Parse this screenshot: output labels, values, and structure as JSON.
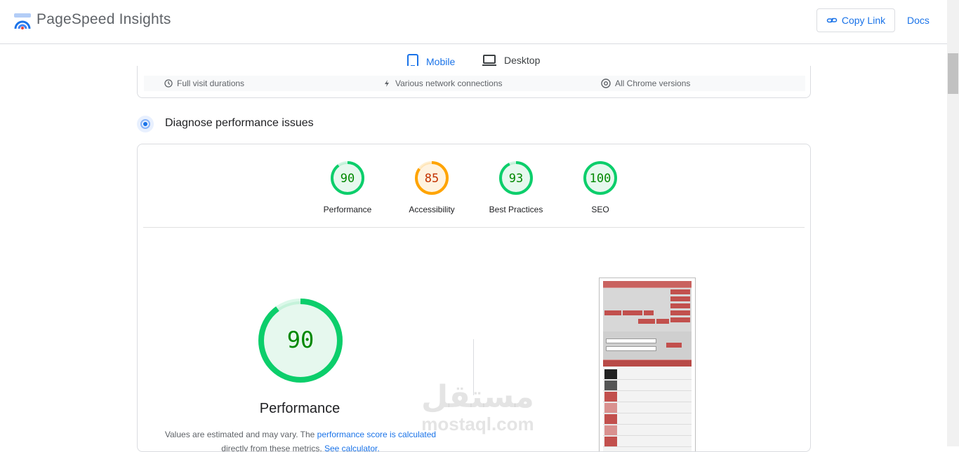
{
  "header": {
    "title": "PageSpeed Insights",
    "copy_link_label": "Copy Link",
    "docs_label": "Docs"
  },
  "tabs": [
    {
      "label": "Mobile",
      "active": true,
      "icon": "smartphone-icon"
    },
    {
      "label": "Desktop",
      "active": false,
      "icon": "laptop-icon"
    }
  ],
  "previous_section": {
    "items": [
      {
        "icon": "clock-icon",
        "label": "Full visit durations"
      },
      {
        "icon": "network-icon",
        "label": "Various network connections"
      },
      {
        "icon": "chrome-icon",
        "label": "All Chrome versions"
      }
    ]
  },
  "diagnose": {
    "title": "Diagnose performance issues"
  },
  "scores": [
    {
      "label": "Performance",
      "value": "90",
      "status": "pass"
    },
    {
      "label": "Accessibility",
      "value": "85",
      "status": "average"
    },
    {
      "label": "Best Practices",
      "value": "93",
      "status": "pass"
    },
    {
      "label": "SEO",
      "value": "100",
      "status": "pass"
    }
  ],
  "performance": {
    "score": "90",
    "title": "Performance",
    "note_prefix": "Values are estimated and may vary. The ",
    "note_link": "performance score is calculated",
    "note_line2_prefix": "directly from these metrics. ",
    "note_link2": "See calculator."
  },
  "watermark": {
    "arabic": "مستقل",
    "latin": "mostaql.com"
  },
  "colors": {
    "pass": "#0cce6b",
    "pass_text": "#008800",
    "pass_bg": "#e6f8ee",
    "average": "#ffa400",
    "average_text": "#c33300",
    "average_bg": "#fff3e0",
    "accent": "#1a73e8"
  }
}
